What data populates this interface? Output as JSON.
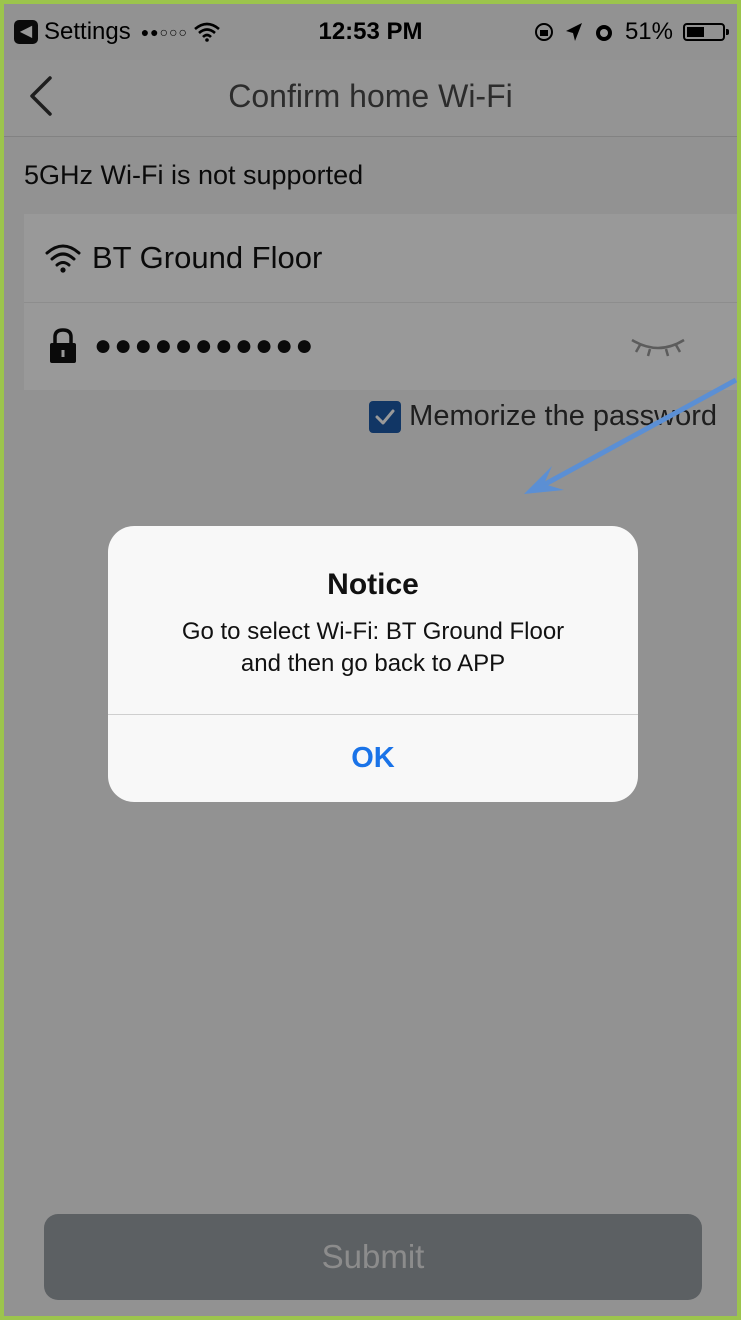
{
  "status_bar": {
    "back_app": "Settings",
    "signal_dots": "●●○○○",
    "time": "12:53 PM",
    "battery_percent": "51%",
    "battery_level": 0.51
  },
  "nav": {
    "title": "Confirm home Wi-Fi"
  },
  "form": {
    "band_notice": "5GHz Wi-Fi is not supported",
    "ssid": "BT Ground Floor",
    "password_masked": "●●●●●●●●●●●",
    "memorize_label": "Memorize the password",
    "memorize_checked": true,
    "submit_label": "Submit"
  },
  "alert": {
    "title": "Notice",
    "message_line1": "Go to select Wi-Fi: BT Ground Floor",
    "message_line2": "and then go back to APP",
    "ok_label": "OK"
  },
  "colors": {
    "accent_blue": "#1a73e8",
    "checkbox_blue": "#1d5aa8",
    "annotation_arrow": "#5b8fd4",
    "frame_border": "#9cc44d"
  }
}
